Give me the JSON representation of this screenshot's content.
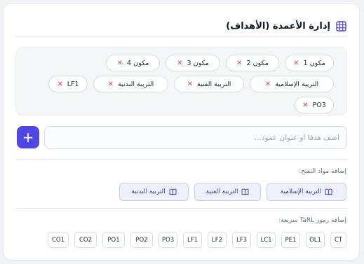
{
  "header": {
    "title": "إدارة الأعمدة (الأهداف)",
    "icon": "table-grid-icon",
    "accent": "#4f46e5"
  },
  "columns": [
    "مكون 1",
    "مكون 2",
    "مكون 3",
    "مكون 4",
    "التربية الإسلامية",
    "التربية الفنية",
    "التربية البدنية",
    "LF1",
    "PO3"
  ],
  "remove_symbol": "✕",
  "new_column": {
    "placeholder": "أضف هدفا أو عنوان عمود...",
    "value": "",
    "add_label": "+"
  },
  "subjects": {
    "label": "إضافة مواد التفتح:",
    "items": [
      "التربية الإسلامية",
      "التربية الفنية",
      "التربية البدنية"
    ],
    "icon": "book-icon"
  },
  "tarl": {
    "label": "إضافة رموز TaRL سريعة:",
    "codes": [
      "CT",
      "OL1",
      "PE1",
      "LC1",
      "LF3",
      "LF2",
      "LF1",
      "PO3",
      "PO2",
      "PO1",
      "CO2",
      "CO1"
    ]
  }
}
